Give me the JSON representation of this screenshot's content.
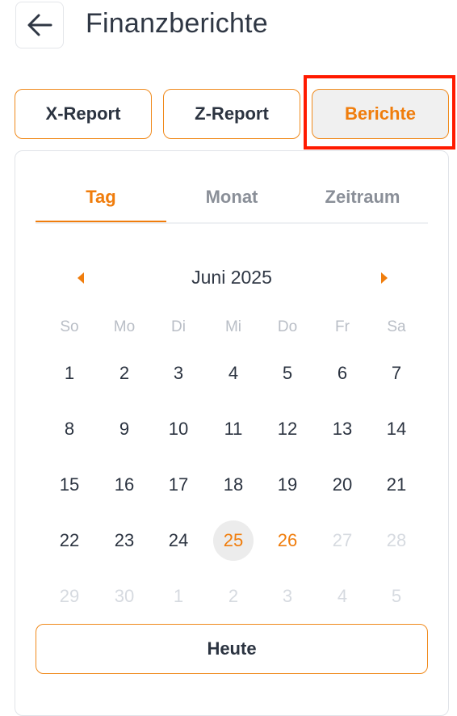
{
  "header": {
    "title": "Finanzberichte"
  },
  "segments": [
    {
      "label": "X-Report",
      "active": false
    },
    {
      "label": "Z-Report",
      "active": false
    },
    {
      "label": "Berichte",
      "active": true
    }
  ],
  "tabs": [
    {
      "label": "Tag",
      "active": true
    },
    {
      "label": "Monat",
      "active": false
    },
    {
      "label": "Zeitraum",
      "active": false
    }
  ],
  "calendar": {
    "month_label": "Juni 2025",
    "weekdays": [
      "So",
      "Mo",
      "Di",
      "Mi",
      "Do",
      "Fr",
      "Sa"
    ],
    "weeks": [
      [
        {
          "d": "1"
        },
        {
          "d": "2"
        },
        {
          "d": "3"
        },
        {
          "d": "4"
        },
        {
          "d": "5"
        },
        {
          "d": "6"
        },
        {
          "d": "7"
        }
      ],
      [
        {
          "d": "8"
        },
        {
          "d": "9"
        },
        {
          "d": "10"
        },
        {
          "d": "11"
        },
        {
          "d": "12"
        },
        {
          "d": "13"
        },
        {
          "d": "14"
        }
      ],
      [
        {
          "d": "15"
        },
        {
          "d": "16"
        },
        {
          "d": "17"
        },
        {
          "d": "18"
        },
        {
          "d": "19"
        },
        {
          "d": "20"
        },
        {
          "d": "21"
        }
      ],
      [
        {
          "d": "22"
        },
        {
          "d": "23"
        },
        {
          "d": "24"
        },
        {
          "d": "25",
          "state": "today"
        },
        {
          "d": "26",
          "state": "orange"
        },
        {
          "d": "27",
          "state": "muted"
        },
        {
          "d": "28",
          "state": "muted"
        }
      ],
      [
        {
          "d": "29",
          "state": "muted"
        },
        {
          "d": "30",
          "state": "muted"
        },
        {
          "d": "1",
          "state": "muted"
        },
        {
          "d": "2",
          "state": "muted"
        },
        {
          "d": "3",
          "state": "muted"
        },
        {
          "d": "4",
          "state": "muted"
        },
        {
          "d": "5",
          "state": "muted"
        }
      ]
    ]
  },
  "today_button": {
    "label": "Heute"
  },
  "colors": {
    "accent": "#f07d0c",
    "highlight": "#ff1a00",
    "text": "#2b3340",
    "muted": "#d6dae0"
  },
  "icons": {
    "back": "arrow-left-icon",
    "prev": "caret-left-icon",
    "next": "caret-right-icon"
  }
}
